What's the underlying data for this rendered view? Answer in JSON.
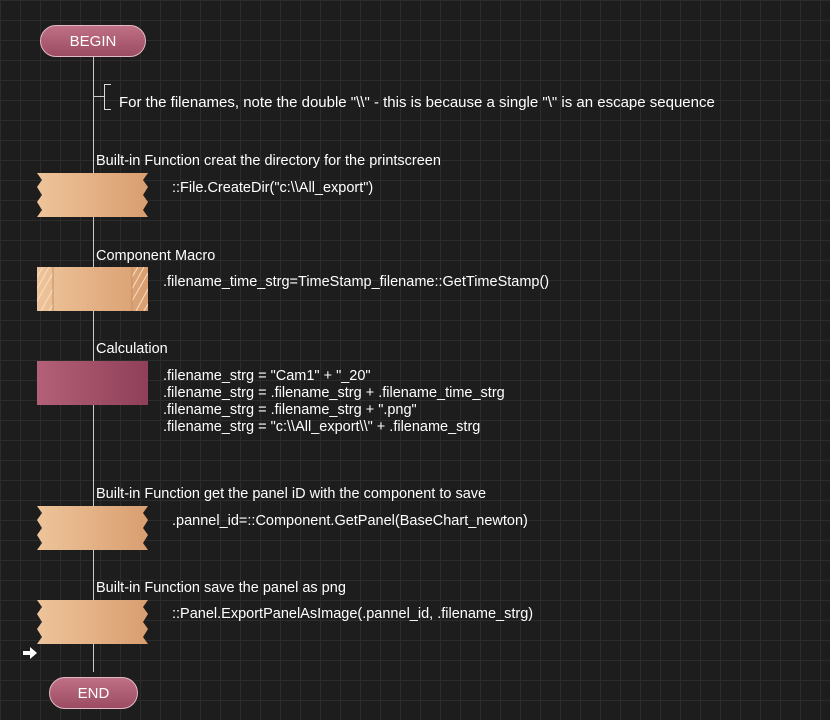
{
  "terminals": {
    "begin": "BEGIN",
    "end": "END"
  },
  "comment": "For the filenames, note the double \"\\\\\" - this is because a single \"\\\" is an escape sequence",
  "steps": [
    {
      "type": "Built-in Function creat the directory for the printscreen",
      "code": [
        "::File.CreateDir(\"c:\\\\All_export\")"
      ],
      "icon": "builtin-function-icon"
    },
    {
      "type": "Component Macro",
      "code": [
        ".filename_time_strg=TimeStamp_filename::GetTimeStamp()"
      ],
      "icon": "component-macro-icon"
    },
    {
      "type": "Calculation",
      "code": [
        ".filename_strg = \"Cam1\" + \"_20\"",
        ".filename_strg = .filename_strg + .filename_time_strg",
        ".filename_strg = .filename_strg + \".png\"",
        ".filename_strg = \"c:\\\\All_export\\\\\" + .filename_strg"
      ],
      "icon": "calculation-icon"
    },
    {
      "type": "Built-in Function get the panel iD with the component to save",
      "code": [
        ".pannel_id=::Component.GetPanel(BaseChart_newton)"
      ],
      "icon": "builtin-function-icon"
    },
    {
      "type": "Built-in Function save the panel as png",
      "code": [
        "::Panel.ExportPanelAsImage(.pannel_id, .filename_strg)"
      ],
      "icon": "builtin-function-icon"
    }
  ],
  "colors": {
    "builtin": "#e8b88a",
    "macro": "#e8b88a",
    "calculation": "#a6536b",
    "terminal": "#b05f75"
  },
  "pointer": "current-step-arrow-icon"
}
